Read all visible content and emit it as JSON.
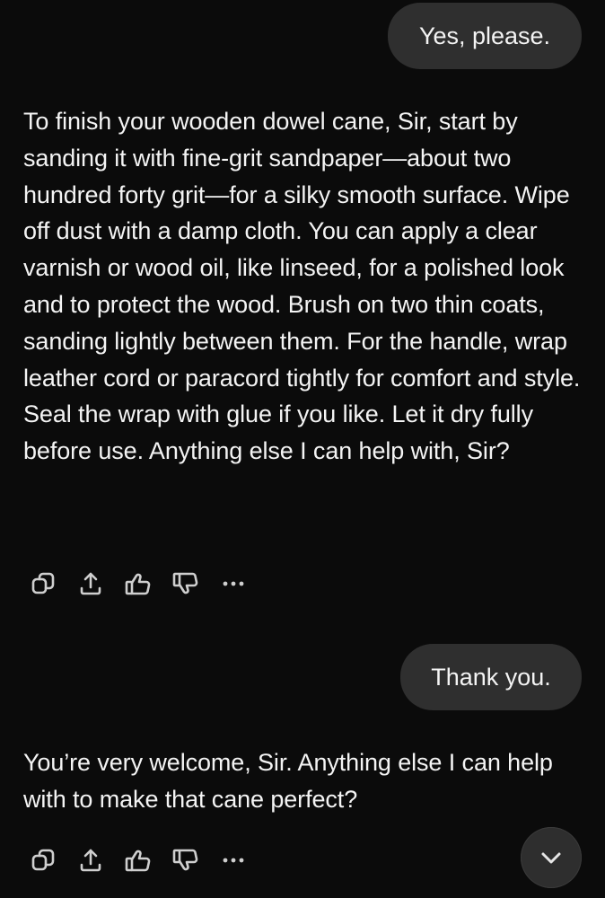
{
  "conversation": {
    "messages": [
      {
        "role": "user",
        "text": "Yes, please."
      },
      {
        "role": "assistant",
        "text": "To finish your wooden dowel cane, Sir, start by sanding it with fine-grit sandpaper—about two hundred forty grit—for a silky smooth surface. Wipe off dust with a damp cloth. You can apply a clear varnish or wood oil, like linseed, for a polished look and to protect the wood. Brush on two thin coats, sanding lightly between them. For the handle, wrap leather cord or paracord tightly for comfort and style. Seal the wrap with glue if you like. Let it dry fully before use. Anything else I can help with, Sir?"
      },
      {
        "role": "user",
        "text": "Thank you."
      },
      {
        "role": "assistant",
        "text": "You’re very welcome, Sir. Anything else I can help with to make that cane perfect?"
      }
    ]
  },
  "message_actions": [
    "copy-icon",
    "share-icon",
    "thumbs-up-icon",
    "thumbs-down-icon",
    "more-icon"
  ],
  "scroll_button": {
    "icon": "chevron-down-icon"
  },
  "colors": {
    "background": "#0b0b0b",
    "user_bubble": "#2f2f2f",
    "text": "#f4f4f4",
    "icon": "#cfcfcf"
  }
}
